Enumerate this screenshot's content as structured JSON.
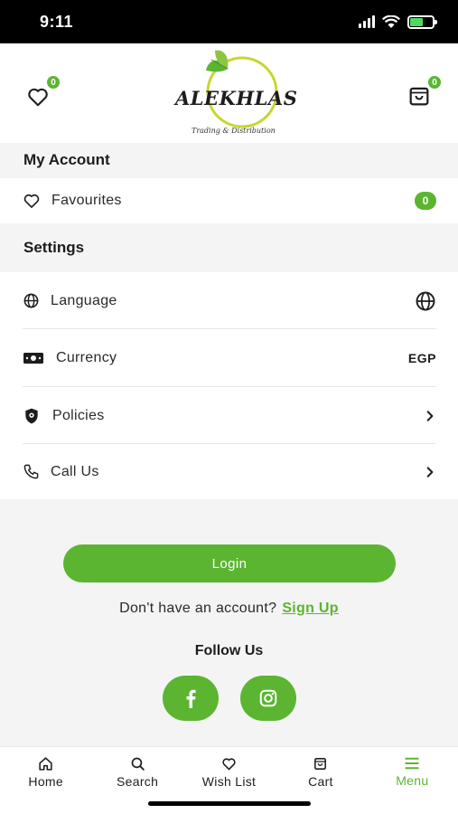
{
  "status_bar": {
    "time": "9:11"
  },
  "header": {
    "wishlist_count": "0",
    "cart_count": "0",
    "logo_text": "ALEKHLAS",
    "logo_tagline": "Trading & Distribution"
  },
  "account": {
    "title": "My Account",
    "favourites_label": "Favourites",
    "favourites_count": "0"
  },
  "settings": {
    "title": "Settings",
    "language_label": "Language",
    "currency_label": "Currency",
    "currency_value": "EGP",
    "policies_label": "Policies",
    "call_label": "Call Us"
  },
  "auth": {
    "login_label": "Login",
    "no_account_text": "Don't have an account?",
    "signup_label": "Sign Up"
  },
  "social": {
    "follow_title": "Follow Us"
  },
  "nav": {
    "home": "Home",
    "search": "Search",
    "wishlist": "Wish List",
    "cart": "Cart",
    "menu": "Menu"
  },
  "colors": {
    "accent": "#5bb531",
    "text": "#1d1d1d",
    "background": "#f4f4f4"
  }
}
